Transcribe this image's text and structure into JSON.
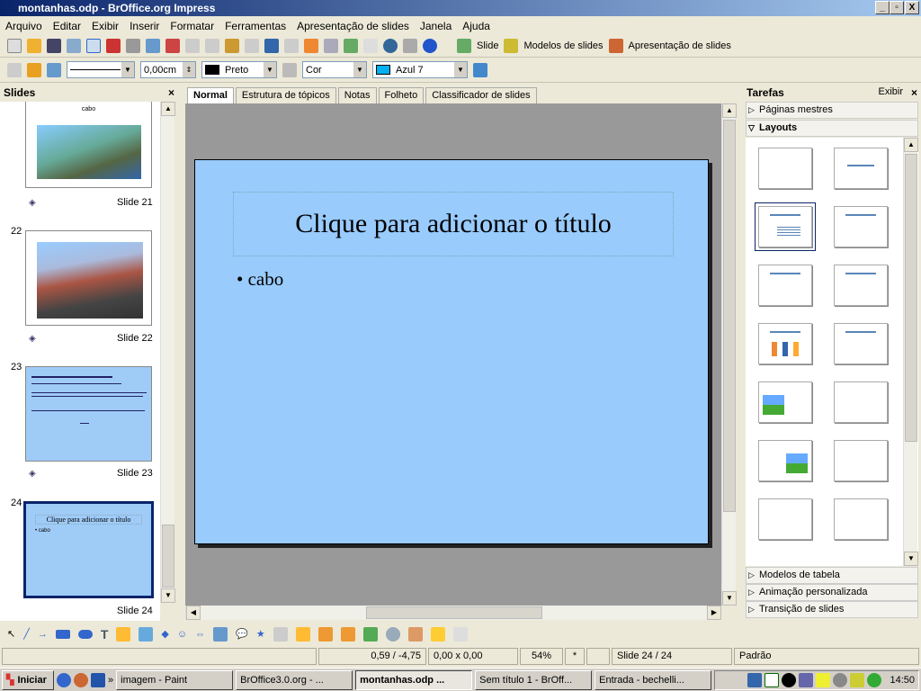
{
  "window": {
    "title": "montanhas.odp - BrOffice.org Impress",
    "min": "_",
    "max": "▫",
    "close": "X"
  },
  "menu": [
    "Arquivo",
    "Editar",
    "Exibir",
    "Inserir",
    "Formatar",
    "Ferramentas",
    "Apresentação de slides",
    "Janela",
    "Ajuda"
  ],
  "toolbar": {
    "slide": "Slide",
    "models": "Modelos de slides",
    "presentation": "Apresentação de slides"
  },
  "format_toolbar": {
    "line_width": "0,00cm",
    "line_color": "Preto",
    "area_style": "Cor",
    "area_color": "Azul 7",
    "line_color_hex": "#000000",
    "area_color_hex": "#00b0f0"
  },
  "slides_panel": {
    "title": "Slides",
    "close": "×",
    "slides": [
      {
        "num": "",
        "label": "Slide 21",
        "title": "cabo"
      },
      {
        "num": "22",
        "label": "Slide 22"
      },
      {
        "num": "23",
        "label": "Slide 23"
      },
      {
        "num": "24",
        "label": "Slide 24",
        "title": "Clique para adicionar o título",
        "bullet": "• cabo"
      }
    ]
  },
  "tabs": [
    "Normal",
    "Estrutura de tópicos",
    "Notas",
    "Folheto",
    "Classificador de slides"
  ],
  "slide": {
    "title": "Clique para adicionar o título",
    "bullet": "cabo",
    "background": "#99cbfd"
  },
  "tasks": {
    "title": "Tarefas",
    "view": "Exibir",
    "close": "×",
    "sections": [
      "Páginas mestres",
      "Layouts",
      "Modelos de tabela",
      "Animação personalizada",
      "Transição de slides"
    ]
  },
  "status": {
    "position": "0,59 / -4,75",
    "size": "0,00 x 0,00",
    "zoom": "54%",
    "modified": "*",
    "slide": "Slide 24 / 24",
    "master": "Padrão"
  },
  "taskbar": {
    "start": "Iniciar",
    "more": "»",
    "items": [
      "imagem - Paint",
      "BrOffice3.0.org - ...",
      "montanhas.odp ...",
      "Sem título 1 - BrOff...",
      "Entrada - bechelli..."
    ],
    "clock": "14:50"
  }
}
